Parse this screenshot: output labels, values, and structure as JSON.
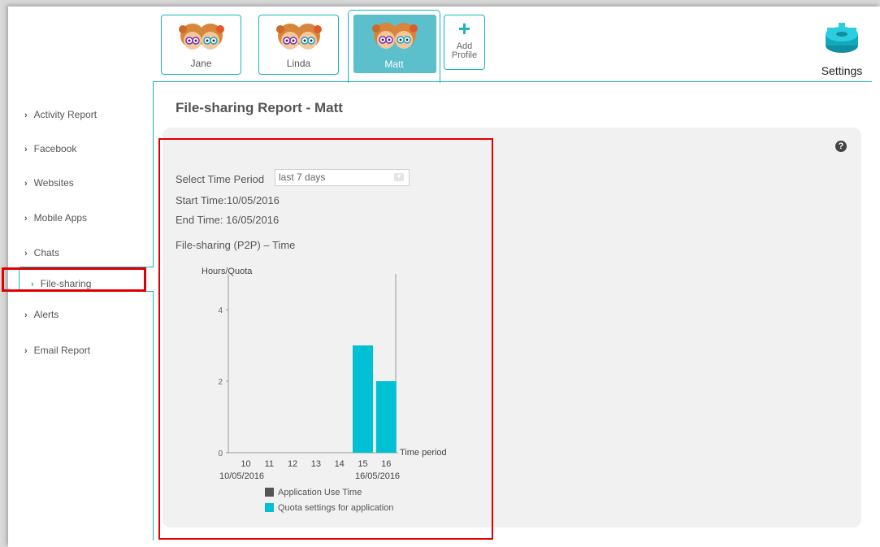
{
  "profiles": [
    {
      "name": "Jane",
      "active": false
    },
    {
      "name": "Linda",
      "active": false
    },
    {
      "name": "Matt",
      "active": true
    }
  ],
  "add_profile": {
    "icon": "plus-icon",
    "label_line1": "Add",
    "label_line2": "Profile"
  },
  "settings": {
    "icon": "gear-icon",
    "label": "Settings"
  },
  "sidebar": {
    "items": [
      {
        "label": "Activity Report"
      },
      {
        "label": "Facebook"
      },
      {
        "label": "Websites"
      },
      {
        "label": "Mobile Apps"
      },
      {
        "label": "Chats"
      },
      {
        "label": "File-sharing",
        "active": true
      },
      {
        "label": "Alerts"
      },
      {
        "label": "Email Report"
      }
    ]
  },
  "report": {
    "title": "File-sharing Report - Matt",
    "time_period_label": "Select Time Period",
    "time_period_value": "last 7 days",
    "start_time": "Start Time:10/05/2016",
    "end_time": "End Time: 16/05/2016",
    "chart_title": "File-sharing (P2P) – Time"
  },
  "colors": {
    "accent": "#19b3c0",
    "quota_bar": "#00c1d4",
    "use_time": "#555555",
    "highlight": "#e00000"
  },
  "chart_data": {
    "type": "bar",
    "title": "File-sharing (P2P) – Time",
    "ylabel": "Hours/Quota",
    "xlabel": "Time period",
    "categories": [
      "10",
      "11",
      "12",
      "13",
      "14",
      "15",
      "16"
    ],
    "date_labels": [
      "10/05/2016",
      "16/05/2016"
    ],
    "yticks": [
      0,
      2,
      4
    ],
    "ylim": [
      0,
      5
    ],
    "series": [
      {
        "name": "Application Use Time",
        "color": "#555555",
        "values": [
          0,
          0,
          0,
          0,
          0,
          0,
          0
        ]
      },
      {
        "name": "Quota settings for application",
        "color": "#00c1d4",
        "values": [
          0,
          0,
          0,
          0,
          0,
          3,
          2
        ]
      }
    ],
    "legend_position": "bottom"
  }
}
